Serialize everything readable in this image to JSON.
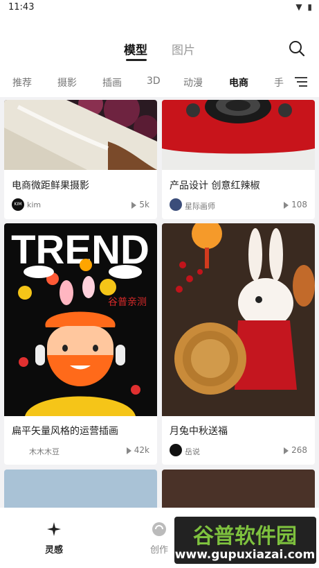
{
  "status": {
    "time": "11:43"
  },
  "header": {
    "tabs": [
      {
        "label": "模型",
        "active": true
      },
      {
        "label": "图片",
        "active": false
      }
    ]
  },
  "categories": [
    {
      "label": "推荐"
    },
    {
      "label": "摄影"
    },
    {
      "label": "插画"
    },
    {
      "label": "3D"
    },
    {
      "label": "动漫"
    },
    {
      "label": "电商",
      "active": true
    },
    {
      "label": "手"
    }
  ],
  "cards": [
    {
      "title": "电商微距鲜果摄影",
      "author": "kim",
      "avatar_text": "KIM",
      "plays": "5k"
    },
    {
      "title": "产品设计 创意红辣椒",
      "author": "星际画师",
      "avatar_text": "",
      "plays": "108"
    },
    {
      "title": "扁平矢量风格的运营插画",
      "author": "木木木豆",
      "avatar_text": "",
      "plays": "42k",
      "image_text": "TREND",
      "overlay_text": "谷普亲测"
    },
    {
      "title": "月兔中秋送福",
      "author": "岳说",
      "avatar_text": "",
      "plays": "268"
    }
  ],
  "bottom_nav": [
    {
      "label": "灵感",
      "active": true
    },
    {
      "label": "创作",
      "active": false
    }
  ],
  "watermark": {
    "text": "谷普软件园",
    "url": "www.gupuxiazai.com"
  }
}
